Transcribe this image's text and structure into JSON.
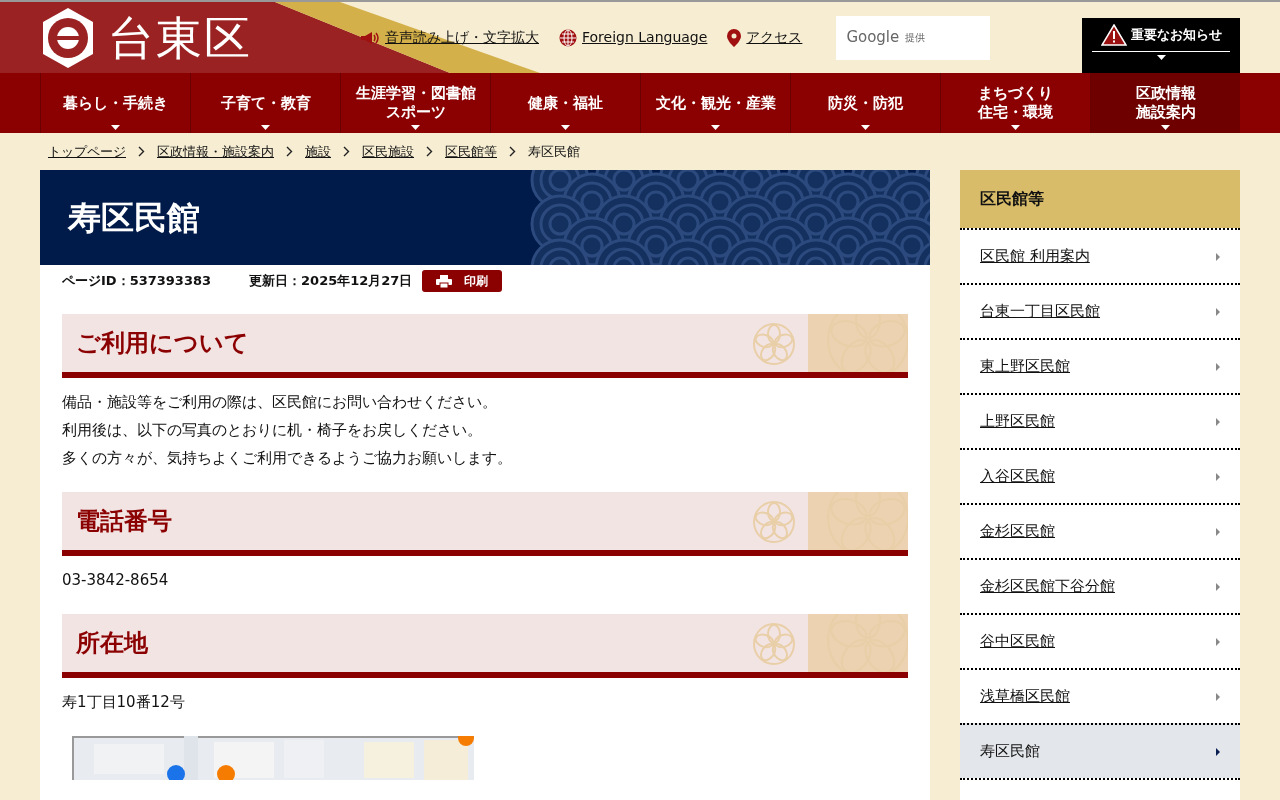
{
  "header": {
    "logo_text": "台東区",
    "links": [
      {
        "kind": "speaker",
        "label": "音声読み上げ・文字拡大"
      },
      {
        "kind": "globe",
        "label": "Foreign Language"
      },
      {
        "kind": "pin",
        "label": "アクセス"
      }
    ],
    "search": {
      "brand": "Google",
      "suffix": "提供"
    },
    "notice": "重要なお知らせ"
  },
  "nav": [
    {
      "lines": [
        "暮らし・手続き"
      ],
      "selected": false
    },
    {
      "lines": [
        "子育て・教育"
      ],
      "selected": false
    },
    {
      "lines": [
        "生涯学習・図書館",
        "スポーツ"
      ],
      "selected": false
    },
    {
      "lines": [
        "健康・福祉"
      ],
      "selected": false
    },
    {
      "lines": [
        "文化・観光・産業"
      ],
      "selected": false
    },
    {
      "lines": [
        "防災・防犯"
      ],
      "selected": false
    },
    {
      "lines": [
        "まちづくり",
        "住宅・環境"
      ],
      "selected": false
    },
    {
      "lines": [
        "区政情報",
        "施設案内"
      ],
      "selected": true
    }
  ],
  "breadcrumb": {
    "links": [
      "トップページ",
      "区政情報・施設案内",
      "施設",
      "区民施設",
      "区民館等"
    ],
    "current": "寿区民館"
  },
  "page": {
    "title": "寿区民館",
    "page_id": "ページID：537393383",
    "updated": "更新日：2025年12月27日",
    "print": "印刷",
    "sections": [
      {
        "heading": "ご利用について",
        "lines": [
          "備品・施設等をご利用の際は、区民館にお問い合わせください。",
          "利用後は、以下の写真のとおりに机・椅子をお戻しください。",
          "多くの方々が、気持ちよくご利用できるようご協力お願いします。"
        ]
      },
      {
        "heading": "電話番号",
        "lines": [
          "03-3842-8654"
        ]
      },
      {
        "heading": "所在地",
        "lines": [
          "寿1丁目10番12号"
        ]
      }
    ]
  },
  "sidebar": {
    "heading": "区民館等",
    "items": [
      {
        "label": "区民館 利用案内",
        "selected": false
      },
      {
        "label": "台東一丁目区民館",
        "selected": false
      },
      {
        "label": "東上野区民館",
        "selected": false
      },
      {
        "label": "上野区民館",
        "selected": false
      },
      {
        "label": "入谷区民館",
        "selected": false
      },
      {
        "label": "金杉区民館",
        "selected": false
      },
      {
        "label": "金杉区民館下谷分館",
        "selected": false
      },
      {
        "label": "谷中区民館",
        "selected": false
      },
      {
        "label": "浅草橋区民館",
        "selected": false
      },
      {
        "label": "寿区民館",
        "selected": true
      }
    ]
  }
}
